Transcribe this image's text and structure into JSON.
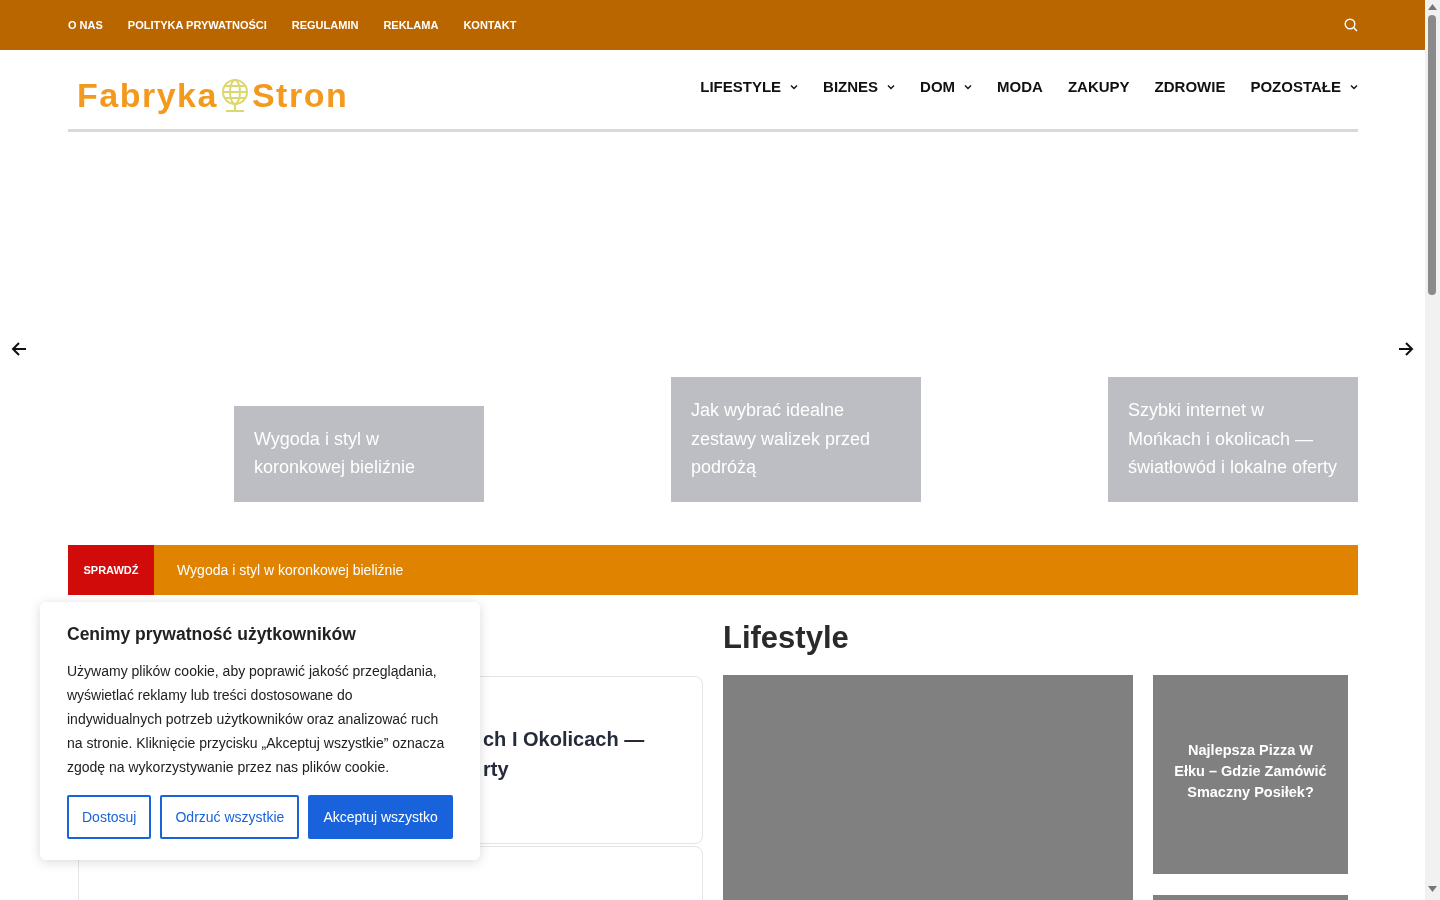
{
  "top_menu": [
    {
      "label": "O NAS"
    },
    {
      "label": "POLITYKA PRYWATNOŚCI"
    },
    {
      "label": "REGULAMIN"
    },
    {
      "label": "REKLAMA"
    },
    {
      "label": "KONTAKT"
    }
  ],
  "logo": {
    "text_before": "Fabryka",
    "text_after": "Stron"
  },
  "main_nav": [
    {
      "label": "LIFESTYLE",
      "has_dropdown": true
    },
    {
      "label": "BIZNES",
      "has_dropdown": true
    },
    {
      "label": "DOM",
      "has_dropdown": true
    },
    {
      "label": "MODA",
      "has_dropdown": false
    },
    {
      "label": "ZAKUPY",
      "has_dropdown": false
    },
    {
      "label": "ZDROWIE",
      "has_dropdown": false
    },
    {
      "label": "POZOSTAŁE",
      "has_dropdown": true
    }
  ],
  "slider": {
    "slides": [
      {
        "title": "Wygoda i styl w koronkowej bieliźnie"
      },
      {
        "title": "Jak wybrać idealne zestawy walizek przed podróżą"
      },
      {
        "title": "Szybki internet w Mońkach i okolicach — światłowód i lokalne oferty"
      }
    ]
  },
  "ticker": {
    "label": "SPRAWDŹ",
    "headline": "Wygoda i styl w koronkowej bieliźnie"
  },
  "left_posts": [
    {
      "kind": "post",
      "title_lines": [
        "ch I Okolicach —",
        "rty"
      ]
    },
    {
      "kind": "empty"
    }
  ],
  "lifestyle": {
    "heading": "Lifestyle",
    "side_posts": [
      {
        "title": "Najlepsza Pizza W Ełku – Gdzie Zamówić Smaczny Posiłek?",
        "kind": "post"
      },
      {
        "kind": "empty"
      }
    ]
  },
  "cookie_banner": {
    "title": "Cenimy prywatność użytkowników",
    "text": "Używamy plików cookie, aby poprawić jakość przeglądania, wyświetlać reklamy lub treści dostosowane do indywidualnych potrzeb użytkowników oraz analizować ruch na stronie. Kliknięcie przycisku „Akceptuj wszystkie” oznacza zgodę na wykorzystywanie przez nas plików cookie.",
    "buttons": [
      {
        "label": "Dostosuj",
        "kind": "outline"
      },
      {
        "label": "Odrzuć wszystkie",
        "kind": "outline"
      },
      {
        "label": "Akceptuj wszystko",
        "kind": "primary"
      }
    ]
  }
}
